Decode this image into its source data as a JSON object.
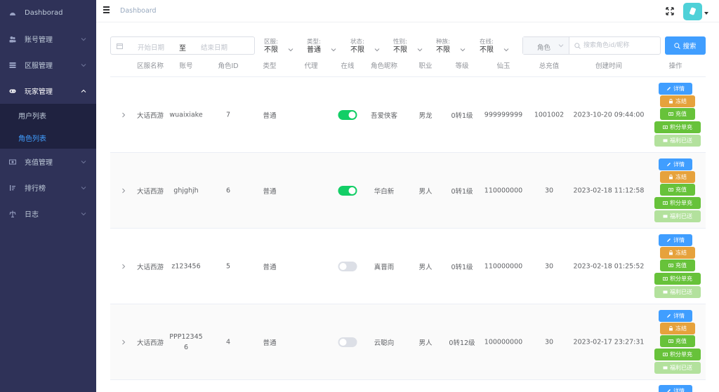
{
  "sidebar": {
    "items": [
      {
        "label": "Dashborad",
        "icon": "dashboard-icon"
      },
      {
        "label": "账号管理",
        "icon": "users-icon"
      },
      {
        "label": "区服管理",
        "icon": "server-icon"
      },
      {
        "label": "玩家管理",
        "icon": "gamepad-icon",
        "open": true,
        "children": [
          {
            "label": "用户列表"
          },
          {
            "label": "角色列表",
            "active": true
          }
        ]
      },
      {
        "label": "充值管理",
        "icon": "money-icon"
      },
      {
        "label": "排行榜",
        "icon": "rank-icon"
      },
      {
        "label": "日志",
        "icon": "log-icon"
      }
    ]
  },
  "header": {
    "breadcrumb": "Dashboard"
  },
  "filters": {
    "date_start_placeholder": "开始日期",
    "date_separator": "至",
    "date_end_placeholder": "结束日期",
    "selects": [
      {
        "label": "区服:",
        "value": "不限"
      },
      {
        "label": "类型:",
        "value": "普通"
      },
      {
        "label": "状态:",
        "value": "不限"
      },
      {
        "label": "性别:",
        "value": "不限"
      },
      {
        "label": "种族:",
        "value": "不限"
      },
      {
        "label": "在线:",
        "value": "不限"
      }
    ],
    "role_select": "角色",
    "search_placeholder": "搜索角色id/昵称",
    "search_button": "搜索"
  },
  "table": {
    "columns": [
      "区服名称",
      "账号",
      "角色ID",
      "类型",
      "代理",
      "在线",
      "角色昵称",
      "职业",
      "等级",
      "仙玉",
      "总充值",
      "创建时间",
      "操作"
    ],
    "rows": [
      {
        "server": "大话西游",
        "account": "wuaixiake",
        "role_id": "7",
        "type": "普通",
        "agent": "",
        "online": true,
        "nickname": "吾爱侠客",
        "job": "男龙",
        "level": "0转1级",
        "jade": "999999999",
        "total_recharge": "1001002",
        "created": "2023-10-20 09:44:00"
      },
      {
        "server": "大话西游",
        "account": "ghjghjh",
        "role_id": "6",
        "type": "普通",
        "agent": "",
        "online": true,
        "nickname": "华白新",
        "job": "男人",
        "level": "0转1级",
        "jade": "110000000",
        "total_recharge": "30",
        "created": "2023-02-18 11:12:58"
      },
      {
        "server": "大话西游",
        "account": "z123456",
        "role_id": "5",
        "type": "普通",
        "agent": "",
        "online": false,
        "nickname": "真晋雨",
        "job": "男人",
        "level": "0转1级",
        "jade": "110000000",
        "total_recharge": "30",
        "created": "2023-02-18 01:25:52"
      },
      {
        "server": "大话西游",
        "account": "PPP123456",
        "role_id": "4",
        "type": "普通",
        "agent": "",
        "online": false,
        "nickname": "云聪向",
        "job": "男人",
        "level": "0转12级",
        "jade": "100000000",
        "total_recharge": "30",
        "created": "2023-02-17 23:27:31"
      }
    ],
    "actions": {
      "detail": "详情",
      "freeze": "冻结",
      "recharge": "充值",
      "points": "积分单充",
      "welfare": "福利已送"
    },
    "partial_next_row_action": "详情"
  },
  "colors": {
    "sidebar_bg": "#2f3258",
    "submenu_bg": "#1f2240",
    "primary": "#409eff",
    "warning": "#e6a23c",
    "success": "#67c23a",
    "switch_on": "#13ce66"
  }
}
